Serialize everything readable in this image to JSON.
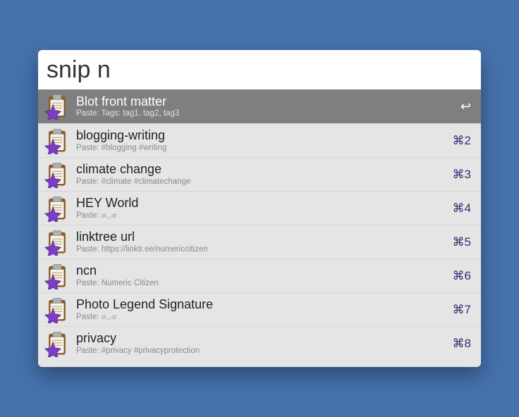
{
  "search": {
    "value": "snip n"
  },
  "results": [
    {
      "title": "Blot front matter",
      "subtitle": "Paste: Tags:  tag1, tag2, tag3",
      "shortcut": "↩",
      "selected": true
    },
    {
      "title": "blogging-writing",
      "subtitle": "Paste: #blogging #writing",
      "shortcut": "⌘2",
      "selected": false
    },
    {
      "title": "climate change",
      "subtitle": "Paste: #climate #climatechange",
      "shortcut": "⌘3",
      "selected": false
    },
    {
      "title": "HEY World",
      "subtitle": "Paste: ಠ◡ಠ",
      "shortcut": "⌘4",
      "selected": false
    },
    {
      "title": "linktree url",
      "subtitle": "Paste: https://linktr.ee/numericcitizen",
      "shortcut": "⌘5",
      "selected": false
    },
    {
      "title": "ncn",
      "subtitle": "Paste: Numeric Citizen",
      "shortcut": "⌘6",
      "selected": false
    },
    {
      "title": "Photo Legend Signature",
      "subtitle": "Paste: ಠ◡ಠ",
      "shortcut": "⌘7",
      "selected": false
    },
    {
      "title": "privacy",
      "subtitle": "Paste: #privacy #privacyprotection",
      "shortcut": "⌘8",
      "selected": false
    }
  ]
}
